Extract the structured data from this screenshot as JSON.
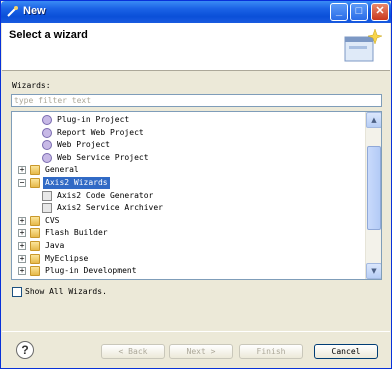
{
  "window": {
    "title": "New",
    "caption_min": "_",
    "caption_max": "□",
    "caption_close": "✕"
  },
  "header": {
    "title": "Select a wizard"
  },
  "wizards_label": "Wizards:",
  "filter": {
    "value": "",
    "placeholder": "type filter text"
  },
  "tree": [
    {
      "label": "Plug-in Project",
      "icon": "gear-project-icon",
      "indent": 1,
      "expander": ""
    },
    {
      "label": "Report Web Project",
      "icon": "report-project-icon",
      "indent": 1,
      "expander": ""
    },
    {
      "label": "Web Project",
      "icon": "web-project-icon",
      "indent": 1,
      "expander": ""
    },
    {
      "label": "Web Service Project",
      "icon": "web-service-icon",
      "indent": 1,
      "expander": ""
    },
    {
      "label": "General",
      "icon": "folder-icon",
      "indent": 0,
      "expander": "+"
    },
    {
      "label": "Axis2 Wizards",
      "icon": "folder-open-icon",
      "indent": 0,
      "expander": "−",
      "selected": true
    },
    {
      "label": "Axis2 Code Generator",
      "icon": "wizard-icon",
      "indent": 1,
      "expander": ""
    },
    {
      "label": "Axis2 Service Archiver",
      "icon": "wizard-icon",
      "indent": 1,
      "expander": ""
    },
    {
      "label": "CVS",
      "icon": "folder-icon",
      "indent": 0,
      "expander": "+"
    },
    {
      "label": "Flash Builder",
      "icon": "folder-icon",
      "indent": 0,
      "expander": "+"
    },
    {
      "label": "Java",
      "icon": "folder-icon",
      "indent": 0,
      "expander": "+"
    },
    {
      "label": "MyEclipse",
      "icon": "folder-icon",
      "indent": 0,
      "expander": "+"
    },
    {
      "label": "Plug-in Development",
      "icon": "folder-icon",
      "indent": 0,
      "expander": "+"
    }
  ],
  "show_all": {
    "label": "Show All Wizards.",
    "checked": false
  },
  "buttons": {
    "help": "?",
    "back": "< Back",
    "next": "Next >",
    "finish": "Finish",
    "cancel": "Cancel"
  },
  "colors": {
    "selection": "#316ac5",
    "titlebar": "#0a4fd8"
  }
}
